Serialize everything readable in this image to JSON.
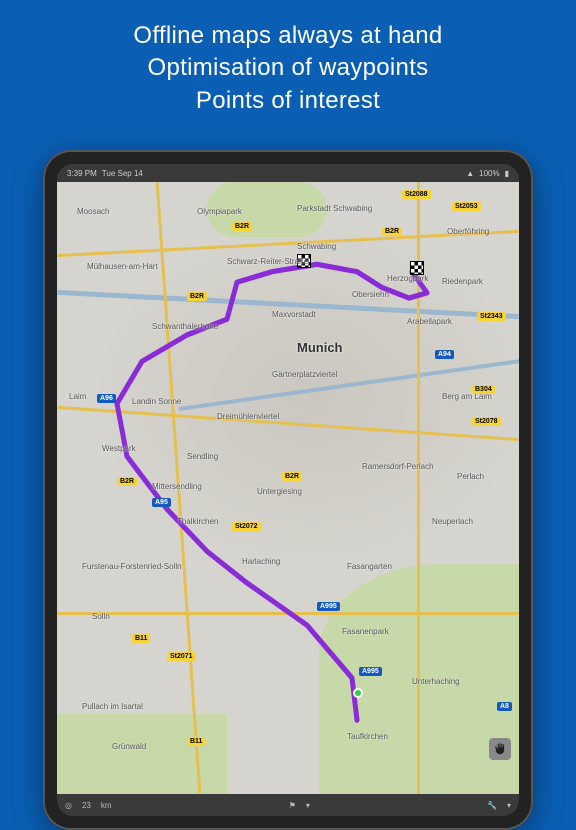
{
  "headline": {
    "line1": "Offline maps always at hand",
    "line2": "Optimisation of waypoints",
    "line3": "Points of interest"
  },
  "statusbar": {
    "time": "3:39 PM",
    "date": "Tue Sep 14",
    "battery": "100%"
  },
  "map": {
    "center_city": "Munich",
    "districts": [
      "Moosach",
      "Olympiapark",
      "Parkstadt Schwabing",
      "Schwabing",
      "Mülhausen-am-Hart",
      "Schwarz-Reiter-Straße",
      "Oberföhring",
      "Herzogpark",
      "Riedenpark",
      "Maxvorstadt",
      "Obersiehn",
      "Schwanthalerhohe",
      "Gärtnerplatzviertel",
      "Arabellapark",
      "Laim",
      "Landin Sonne",
      "Dreimühlenviertel",
      "Berg am Laim",
      "Westpark",
      "Sendling",
      "Mittersendling",
      "Ramersdorf-Perlach",
      "Thalkirchen",
      "Untergiesing",
      "Perlach",
      "Neuperlach",
      "Furstenau-Forstenried-Solln",
      "Harlaching",
      "Fasangarten",
      "Fasanenpark",
      "Solln",
      "Grünwald",
      "Unterhaching",
      "Taufkirchen",
      "Pullach im Isartal"
    ],
    "road_signs": {
      "state": [
        "St2088",
        "St2053",
        "St2343",
        "St2078",
        "St2072",
        "St2071"
      ],
      "bundes": [
        "B2R",
        "B2R",
        "B2R",
        "B2R",
        "B2R",
        "B304",
        "B11",
        "B11"
      ],
      "autobahn": [
        "A96",
        "A94",
        "A95",
        "A995",
        "A995",
        "A8"
      ]
    },
    "route": {
      "has_start": true,
      "has_finish": true
    }
  },
  "bottombar": {
    "speed": "23",
    "speed_unit": "km"
  },
  "icons": {
    "gps": "gps-icon",
    "flag": "finish-flag-icon",
    "wrench": "wrench-icon",
    "hand": "pan-hand-icon"
  }
}
